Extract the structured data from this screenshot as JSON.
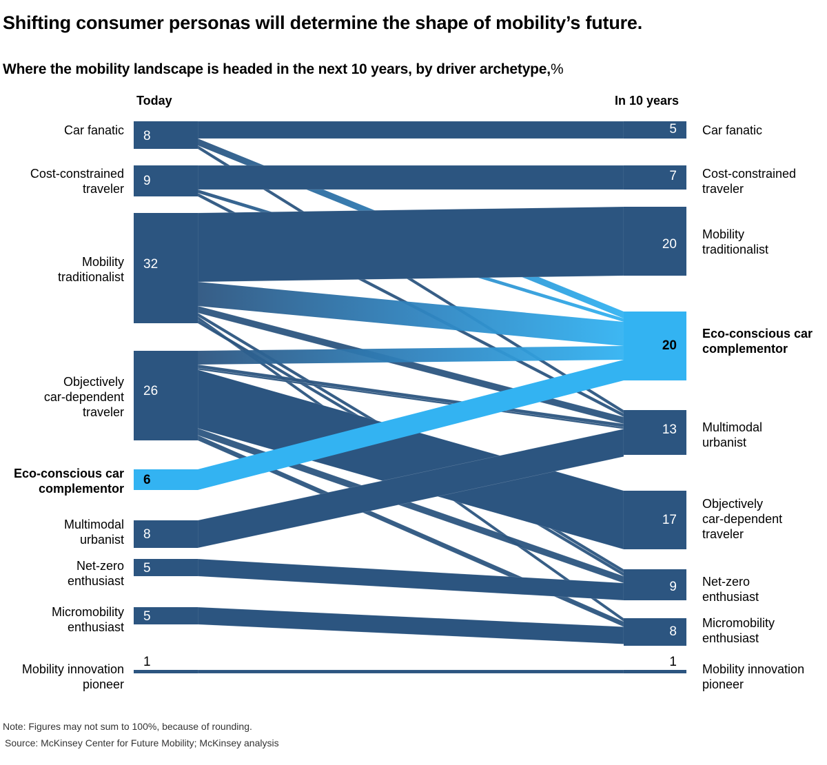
{
  "header": {
    "title": "Shifting consumer personas will determine the shape of mobility’s future.",
    "subtitle": "Where the mobility landscape is headed in the next 10 years, by driver archetype,",
    "unit": "%"
  },
  "footer": {
    "note": "Note: Figures may not sum to 100%, because of rounding.",
    "source": "Source: McKinsey Center for Future Mobility; McKinsey analysis"
  },
  "colors": {
    "node": "#2c5580",
    "highlight": "#33b3f2",
    "crossing": "#0c1f44",
    "text_on_dark": "#ffffff",
    "text": "#000000"
  },
  "chart_data": {
    "type": "sankey",
    "title": "Where the mobility landscape is headed in the next 10 years, by driver archetype, %",
    "left_column_label": "Today",
    "right_column_label": "In 10 years",
    "highlight": "Eco-conscious car complementor",
    "left_nodes": [
      {
        "id": "car_fanatic",
        "label": "Car fanatic",
        "value": 8
      },
      {
        "id": "cost_constrained",
        "label": "Cost-constrained traveler",
        "value": 9
      },
      {
        "id": "mobility_traditionalist",
        "label": "Mobility traditionalist",
        "value": 32
      },
      {
        "id": "objectively_car_dependent",
        "label": "Objectively car-dependent traveler",
        "value": 26
      },
      {
        "id": "eco_conscious",
        "label": "Eco-conscious car complementor",
        "value": 6
      },
      {
        "id": "multimodal_urbanist",
        "label": "Multimodal urbanist",
        "value": 8
      },
      {
        "id": "net_zero",
        "label": "Net-zero enthusiast",
        "value": 5
      },
      {
        "id": "micromobility",
        "label": "Micromobility enthusiast",
        "value": 5
      },
      {
        "id": "innovation_pioneer",
        "label": "Mobility innovation pioneer",
        "value": 1
      }
    ],
    "right_nodes": [
      {
        "id": "car_fanatic",
        "label": "Car fanatic",
        "value": 5
      },
      {
        "id": "cost_constrained",
        "label": "Cost-constrained traveler",
        "value": 7
      },
      {
        "id": "mobility_traditionalist",
        "label": "Mobility traditionalist",
        "value": 20
      },
      {
        "id": "eco_conscious",
        "label": "Eco-conscious car complementor",
        "value": 20
      },
      {
        "id": "multimodal_urbanist",
        "label": "Multimodal urbanist",
        "value": 13
      },
      {
        "id": "objectively_car_dependent",
        "label": "Objectively car-dependent traveler",
        "value": 17
      },
      {
        "id": "net_zero",
        "label": "Net-zero enthusiast",
        "value": 9
      },
      {
        "id": "micromobility",
        "label": "Micromobility enthusiast",
        "value": 8
      },
      {
        "id": "innovation_pioneer",
        "label": "Mobility innovation pioneer",
        "value": 1
      }
    ],
    "flows": [
      {
        "from": "car_fanatic",
        "to": "car_fanatic",
        "value": 5
      },
      {
        "from": "car_fanatic",
        "to": "eco_conscious",
        "value": 2
      },
      {
        "from": "car_fanatic",
        "to": "multimodal_urbanist",
        "value": 1
      },
      {
        "from": "cost_constrained",
        "to": "cost_constrained",
        "value": 7
      },
      {
        "from": "cost_constrained",
        "to": "eco_conscious",
        "value": 1
      },
      {
        "from": "cost_constrained",
        "to": "multimodal_urbanist",
        "value": 1
      },
      {
        "from": "mobility_traditionalist",
        "to": "mobility_traditionalist",
        "value": 20
      },
      {
        "from": "mobility_traditionalist",
        "to": "eco_conscious",
        "value": 7
      },
      {
        "from": "mobility_traditionalist",
        "to": "multimodal_urbanist",
        "value": 2
      },
      {
        "from": "mobility_traditionalist",
        "to": "net_zero",
        "value": 1
      },
      {
        "from": "mobility_traditionalist",
        "to": "micromobility",
        "value": 1
      },
      {
        "from": "mobility_traditionalist",
        "to": "net_zero",
        "value": 1
      },
      {
        "from": "objectively_car_dependent",
        "to": "eco_conscious",
        "value": 4
      },
      {
        "from": "objectively_car_dependent",
        "to": "multimodal_urbanist",
        "value": 1
      },
      {
        "from": "objectively_car_dependent",
        "to": "multimodal_urbanist",
        "value": 0.5
      },
      {
        "from": "objectively_car_dependent",
        "to": "objectively_car_dependent",
        "value": 17
      },
      {
        "from": "objectively_car_dependent",
        "to": "net_zero",
        "value": 2
      },
      {
        "from": "objectively_car_dependent",
        "to": "micromobility",
        "value": 1.5
      },
      {
        "from": "eco_conscious",
        "to": "eco_conscious",
        "value": 6
      },
      {
        "from": "multimodal_urbanist",
        "to": "multimodal_urbanist",
        "value": 8
      },
      {
        "from": "net_zero",
        "to": "net_zero",
        "value": 5
      },
      {
        "from": "micromobility",
        "to": "micromobility",
        "value": 5
      },
      {
        "from": "innovation_pioneer",
        "to": "innovation_pioneer",
        "value": 1
      }
    ]
  }
}
